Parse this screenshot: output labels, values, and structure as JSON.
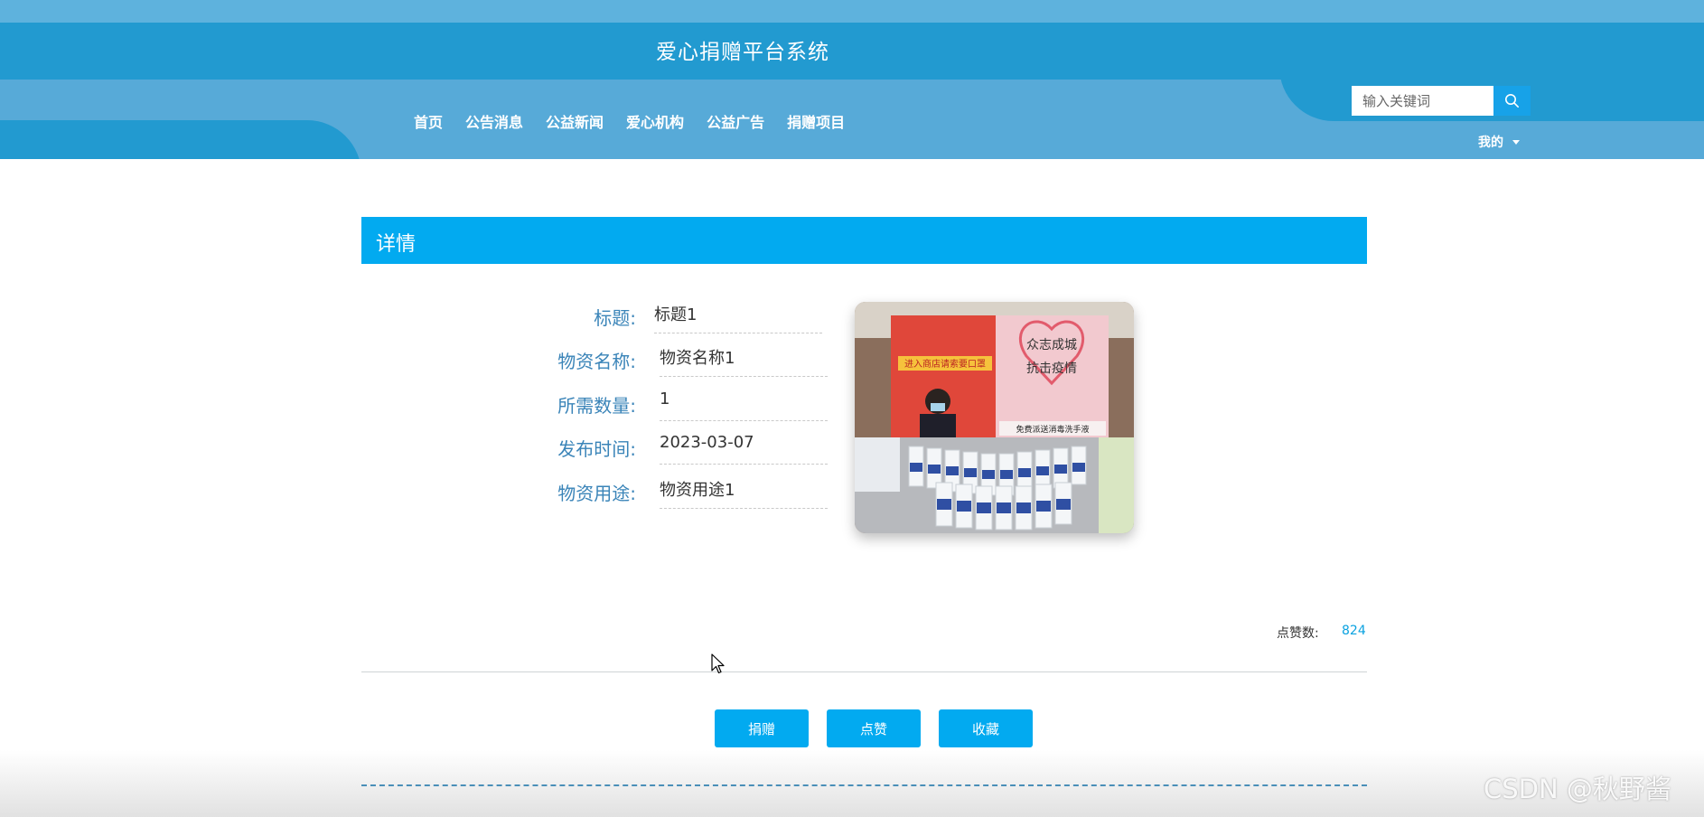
{
  "header": {
    "site_title": "爱心捐赠平台系统",
    "nav": [
      "首页",
      "公告消息",
      "公益新闻",
      "爱心机构",
      "公益广告",
      "捐赠项目"
    ],
    "search": {
      "placeholder": "输入关键词",
      "icon": "search-icon"
    },
    "user_menu": {
      "label": "我的",
      "icon": "caret-down-icon"
    }
  },
  "detail": {
    "heading": "详情",
    "fields": [
      {
        "label": "标题:",
        "value": "标题1"
      },
      {
        "label": "物资名称:",
        "value": "物资名称1"
      },
      {
        "label": "所需数量:",
        "value": "1"
      },
      {
        "label": "发布时间:",
        "value": "2023-03-07"
      },
      {
        "label": "物资用途:",
        "value": "物资用途1"
      }
    ],
    "image": {
      "poster_left_text": "进入商店请索要口罩",
      "poster_right_line1": "众志成城",
      "poster_right_line2": "抗击疫情",
      "poster_right_bottom": "免费派送消毒洗手液"
    },
    "likes_label": "点赞数:",
    "likes_value": "824"
  },
  "actions": {
    "donate": "捐赠",
    "like": "点赞",
    "favorite": "收藏"
  },
  "watermark": "CSDN @秋野酱",
  "colors": {
    "header_blue": "#229ad0",
    "header_light": "#57aad8",
    "accent": "#02aaf0",
    "label_blue": "#3a84b8"
  }
}
